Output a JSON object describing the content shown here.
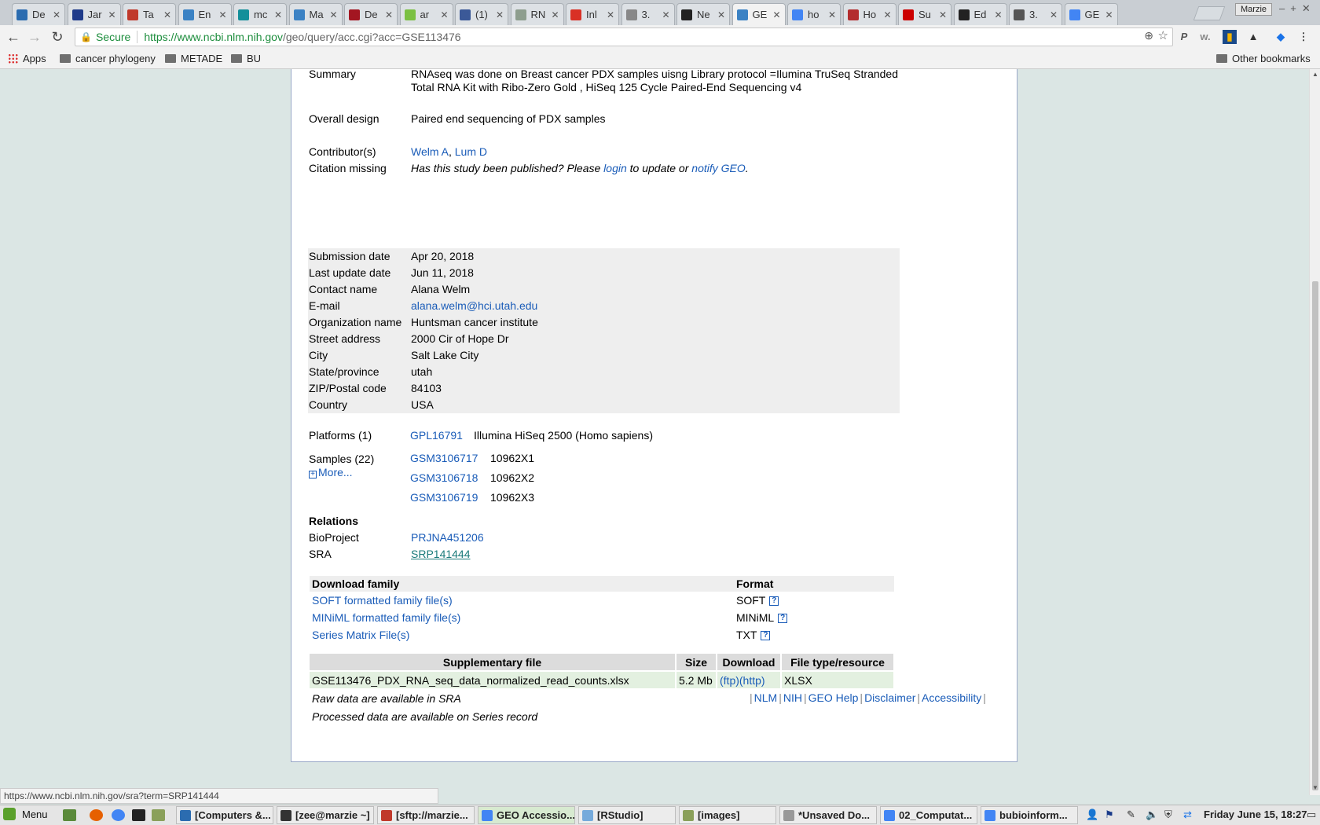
{
  "browser": {
    "tabs": [
      {
        "label": "De",
        "color": "#2b6cb0"
      },
      {
        "label": "Jar",
        "color": "#1e3a8a"
      },
      {
        "label": "Ta",
        "color": "#c0392b"
      },
      {
        "label": "En",
        "color": "#3b82c4"
      },
      {
        "label": "mc",
        "color": "#138f9a"
      },
      {
        "label": "Ma",
        "color": "#3b82c4"
      },
      {
        "label": "De",
        "color": "#a31621"
      },
      {
        "label": "ar",
        "color": "#7bc043"
      },
      {
        "label": "(1)",
        "color": "#3b5998"
      },
      {
        "label": "RN",
        "color": "#8e9e8e"
      },
      {
        "label": "Inl",
        "color": "#d93025"
      },
      {
        "label": "3.",
        "color": "#888888"
      },
      {
        "label": "Ne",
        "color": "#222222"
      },
      {
        "label": "GE",
        "color": "#3b82c4"
      },
      {
        "label": "ho",
        "color": "#4285f4"
      },
      {
        "label": "Ho",
        "color": "#b32d2e"
      },
      {
        "label": "Su",
        "color": "#cc0000"
      },
      {
        "label": "Ed",
        "color": "#222222"
      },
      {
        "label": "3.",
        "color": "#555555"
      },
      {
        "label": "GE",
        "color": "#4285f4"
      }
    ],
    "active_tab": 13,
    "profile": "Marzie",
    "window_controls": "–+✕",
    "secure_label": "Secure",
    "url_host": "https://www.ncbi.nlm.nih.gov",
    "url_rest": "/geo/query/acc.cgi?acc=GSE113476",
    "bookmarks": {
      "apps": "Apps",
      "folders": [
        "cancer phylogeny",
        "METADE",
        "BU"
      ],
      "other": "Other bookmarks"
    },
    "status_url": "https://www.ncbi.nlm.nih.gov/sra?term=SRP141444"
  },
  "geo": {
    "summary_label": "Summary",
    "summary_text": "RNAseq was done on Breast cancer PDX samples uisng Library protocol =Ilumina TruSeq Stranded Total RNA Kit with Ribo-Zero Gold , HiSeq 125 Cycle Paired-End Sequencing v4",
    "design_label": "Overall design",
    "design_text": "Paired end sequencing of PDX samples",
    "contributors_label": "Contributor(s)",
    "contributors": [
      "Welm A",
      "Lum D"
    ],
    "contributor_sep": ",",
    "citation_label": "Citation missing",
    "citation_text_1": "Has this study been published? Please",
    "citation_login": "login",
    "citation_text_2": "to update or",
    "citation_notify": "notify GEO",
    "citation_end": ".",
    "contact": [
      {
        "label": "Submission date",
        "value": "Apr 20, 2018"
      },
      {
        "label": "Last update date",
        "value": "Jun 11, 2018"
      },
      {
        "label": "Contact name",
        "value": "Alana Welm"
      },
      {
        "label": "E-mail",
        "value": "alana.welm@hci.utah.edu",
        "link": true
      },
      {
        "label": "Organization name",
        "value": "Huntsman cancer institute"
      },
      {
        "label": "Street address",
        "value": "2000 Cir of Hope Dr"
      },
      {
        "label": "City",
        "value": "Salt Lake City"
      },
      {
        "label": "State/province",
        "value": "utah"
      },
      {
        "label": "ZIP/Postal code",
        "value": "84103"
      },
      {
        "label": "Country",
        "value": "USA"
      }
    ],
    "platforms_label": "Platforms (1)",
    "platform_id": "GPL16791",
    "platform_desc": "Illumina HiSeq 2500 (Homo sapiens)",
    "samples_label": "Samples (22)",
    "more_label": "More...",
    "samples": [
      {
        "id": "GSM3106717",
        "name": "10962X1"
      },
      {
        "id": "GSM3106718",
        "name": "10962X2"
      },
      {
        "id": "GSM3106719",
        "name": "10962X3"
      }
    ],
    "relations_label": "Relations",
    "bioproject_label": "BioProject",
    "bioproject_id": "PRJNA451206",
    "sra_label": "SRA",
    "sra_id": "SRP141444",
    "download_header": "Download family",
    "format_header": "Format",
    "downloads": [
      {
        "label": "SOFT formatted family file(s)",
        "format": "SOFT"
      },
      {
        "label": "MINiML formatted family file(s)",
        "format": "MINiML"
      },
      {
        "label": "Series Matrix File(s)",
        "format": "TXT"
      }
    ],
    "help_glyph": "?",
    "supp_headers": [
      "Supplementary file",
      "Size",
      "Download",
      "File type/resource"
    ],
    "supp_file": "GSE113476_PDX_RNA_seq_data_normalized_read_counts.xlsx",
    "supp_size": "5.2 Mb",
    "supp_ftp": "(ftp)",
    "supp_http": "(http)",
    "supp_type": "XLSX",
    "raw_note": "Raw data are available in SRA",
    "processed_note": "Processed data are available on Series record",
    "footer_links": [
      "NLM",
      "NIH",
      "GEO Help",
      "Disclaimer",
      "Accessibility"
    ]
  },
  "taskbar": {
    "menu_label": "Menu",
    "tasks": [
      {
        "label": "[Computers &...",
        "color": "#2b6cb0"
      },
      {
        "label": "[zee@marzie ~]",
        "color": "#333333"
      },
      {
        "label": "[sftp://marzie...",
        "color": "#c0392b"
      },
      {
        "label": "GEO Accessio...",
        "color": "#4285f4"
      },
      {
        "label": "[RStudio]",
        "color": "#75aadb"
      },
      {
        "label": "[images]",
        "color": "#8aa05a"
      },
      {
        "label": "*Unsaved Do...",
        "color": "#999999"
      },
      {
        "label": "02_Computat...",
        "color": "#4285f4"
      },
      {
        "label": "bubioinform...",
        "color": "#4285f4"
      }
    ],
    "active_task": 3,
    "clock": "Friday June 15, 18:27"
  }
}
